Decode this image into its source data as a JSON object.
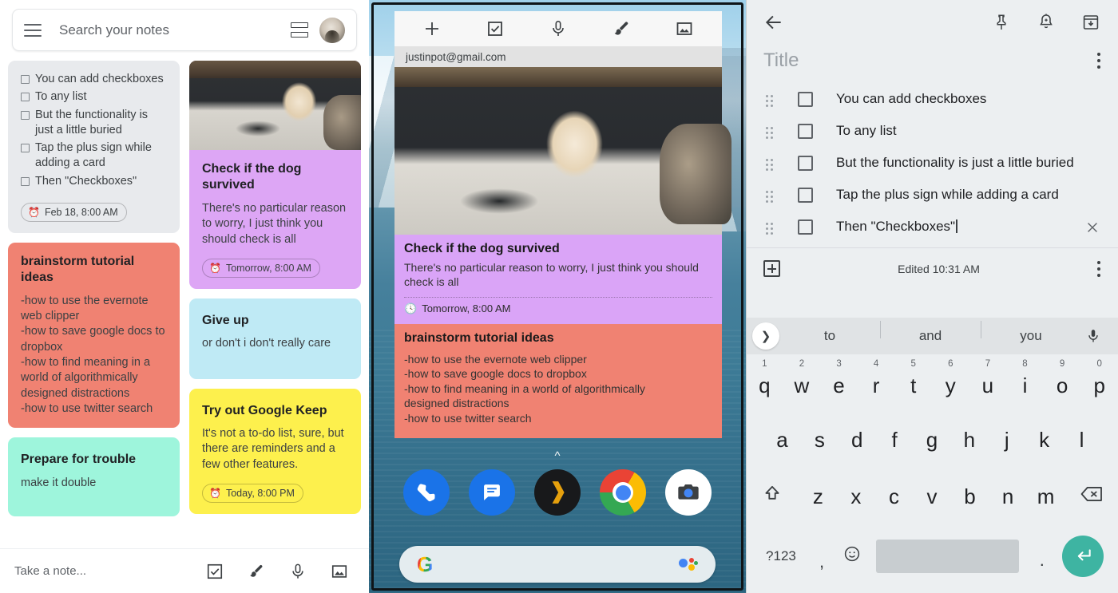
{
  "web": {
    "search": {
      "placeholder": "Search your notes",
      "icon": "hamburger-menu-icon",
      "view_toggle_icon": "list-view-icon",
      "avatar_icon": "user-avatar"
    },
    "notes": [
      {
        "id": "checkbox-note",
        "type": "checklist",
        "color": "#e8eaed",
        "items": [
          "You can add checkboxes",
          "To any list",
          "But the functionality is just a little buried",
          "Tap the plus sign while adding a card",
          "Then \"Checkboxes\""
        ],
        "reminder": "Feb 18, 8:00 AM"
      },
      {
        "id": "dog-note",
        "type": "photo",
        "color": "#dda6f5",
        "title": "Check if the dog survived",
        "body": "There's no particular reason to worry, I just think you should check is all",
        "reminder": "Tomorrow, 8:00 AM"
      },
      {
        "id": "brainstorm-note",
        "type": "text",
        "color": "#f08272",
        "title": "brainstorm tutorial ideas",
        "body": "-how to use the evernote web clipper\n-how to save google docs to dropbox\n-how to find meaning in a world of algorithmically designed distractions\n-how to use twitter search"
      },
      {
        "id": "giveup-note",
        "type": "text",
        "color": "#bfeaf5",
        "title": "Give up",
        "body": "or don't i don't really care"
      },
      {
        "id": "prepare-note",
        "type": "text",
        "color": "#9ef5dc",
        "title": "Prepare for trouble",
        "body": "make it double"
      },
      {
        "id": "keep-note",
        "type": "text",
        "color": "#fdf04d",
        "title": "Try out Google Keep",
        "body": "It's not a to-do list, sure, but there are reminders and a few other features.",
        "reminder": "Today, 8:00 PM"
      }
    ],
    "take_note": {
      "placeholder": "Take a note...",
      "icons": [
        "checkbox-icon",
        "brush-icon",
        "microphone-icon",
        "image-icon"
      ]
    }
  },
  "phone": {
    "widget": {
      "toolbar_icons": [
        "plus-icon",
        "checkbox-icon",
        "microphone-icon",
        "brush-icon",
        "image-icon"
      ],
      "account": "justinpot@gmail.com",
      "notes": [
        {
          "id": "widget-dog-note",
          "color": "#daa4f7",
          "title": "Check if the dog survived",
          "body": "There's no particular reason to worry, I just think you should check is all",
          "reminder": "Tomorrow, 8:00 AM"
        },
        {
          "id": "widget-brainstorm-note",
          "color": "#f08272",
          "title": "brainstorm tutorial ideas",
          "body": "-how to use the evernote web clipper\n-how to save google docs to dropbox\n-how to find meaning in a world of algorithmically\ndesigned distractions\n-how to use twitter search"
        }
      ]
    },
    "dock": [
      "phone-app-icon",
      "messages-app-icon",
      "plex-app-icon",
      "chrome-app-icon",
      "camera-app-icon"
    ],
    "search_widget": {
      "logo": "google-g-logo",
      "assistant": "google-assistant-icon"
    },
    "drawer_handle": "chevron-up-icon"
  },
  "editor": {
    "top_icons": [
      "back-arrow-icon",
      "pin-icon",
      "reminder-bell-icon",
      "archive-icon"
    ],
    "title_placeholder": "Title",
    "menu_icon": "overflow-menu-icon",
    "items": [
      {
        "text": "You can add checkboxes",
        "checked": false,
        "focused": false
      },
      {
        "text": "To any list",
        "checked": false,
        "focused": false
      },
      {
        "text": "But the functionality is just a little buried",
        "checked": false,
        "focused": false
      },
      {
        "text": "Tap the plus sign while adding a card",
        "checked": false,
        "focused": false
      },
      {
        "text": "Then \"Checkboxes\"",
        "checked": false,
        "focused": true
      }
    ],
    "footer": {
      "add_icon": "add-box-icon",
      "edited": "Edited 10:31 AM",
      "menu_icon": "overflow-menu-icon"
    }
  },
  "keyboard": {
    "suggestions": [
      "to",
      "and",
      "you"
    ],
    "expand_icon": "chevron-right-icon",
    "mic_icon": "microphone-icon",
    "row1": [
      {
        "k": "q",
        "n": "1"
      },
      {
        "k": "w",
        "n": "2"
      },
      {
        "k": "e",
        "n": "3"
      },
      {
        "k": "r",
        "n": "4"
      },
      {
        "k": "t",
        "n": "5"
      },
      {
        "k": "y",
        "n": "6"
      },
      {
        "k": "u",
        "n": "7"
      },
      {
        "k": "i",
        "n": "8"
      },
      {
        "k": "o",
        "n": "9"
      },
      {
        "k": "p",
        "n": "0"
      }
    ],
    "row2": [
      "a",
      "s",
      "d",
      "f",
      "g",
      "h",
      "j",
      "k",
      "l"
    ],
    "row3": [
      "z",
      "x",
      "c",
      "v",
      "b",
      "n",
      "m"
    ],
    "shift_icon": "shift-key-icon",
    "backspace_icon": "backspace-key-icon",
    "symbols_key": "?123",
    "comma_key": ",",
    "emoji_icon": "emoji-key-icon",
    "period_key": ".",
    "enter_icon": "enter-key-icon",
    "accent": "#3eb4a2"
  }
}
